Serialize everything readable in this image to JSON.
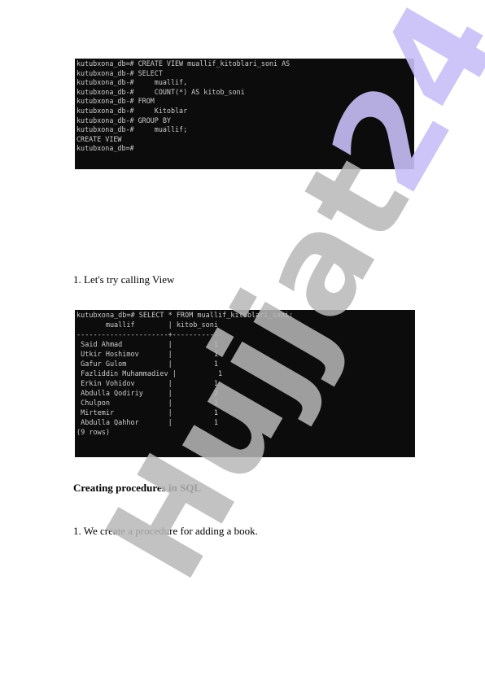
{
  "terminal1": {
    "lines": [
      "kutubxona_db=# CREATE VIEW muallif_kitoblari_soni AS",
      "kutubxona_db-# SELECT",
      "kutubxona_db-#     muallif,",
      "kutubxona_db-#     COUNT(*) AS kitob_soni",
      "kutubxona_db-# FROM",
      "kutubxona_db-#     Kitoblar",
      "kutubxona_db-# GROUP BY",
      "kutubxona_db-#     muallif;",
      "CREATE VIEW",
      "kutubxona_db=#"
    ]
  },
  "paragraph1": "1. Let's try calling View",
  "terminal2": {
    "lines": [
      "kutubxona_db=# SELECT * FROM muallif_kitoblari_soni;",
      "       muallif        | kitob_soni",
      "----------------------+------------",
      " Said Ahmad           |          1",
      " Utkir Hoshimov       |          1",
      " Gafur Gulom          |          1",
      " Fazliddin Muhammadiev |          1",
      " Erkin Vohidov        |          1",
      " Abdulla Qodiriy      |          2",
      " Chulpon              |          1",
      " Mirtemir             |          1",
      " Abdulla Qahhor       |          1",
      "(9 rows)"
    ]
  },
  "heading1": "Creating procedures in SQL",
  "paragraph2": "1. We create a procedure for adding a book.",
  "watermark": {
    "part1": "Hujjat",
    "part2": "24",
    "color1": "#b8b8b8",
    "color2": "#c8bff8"
  }
}
